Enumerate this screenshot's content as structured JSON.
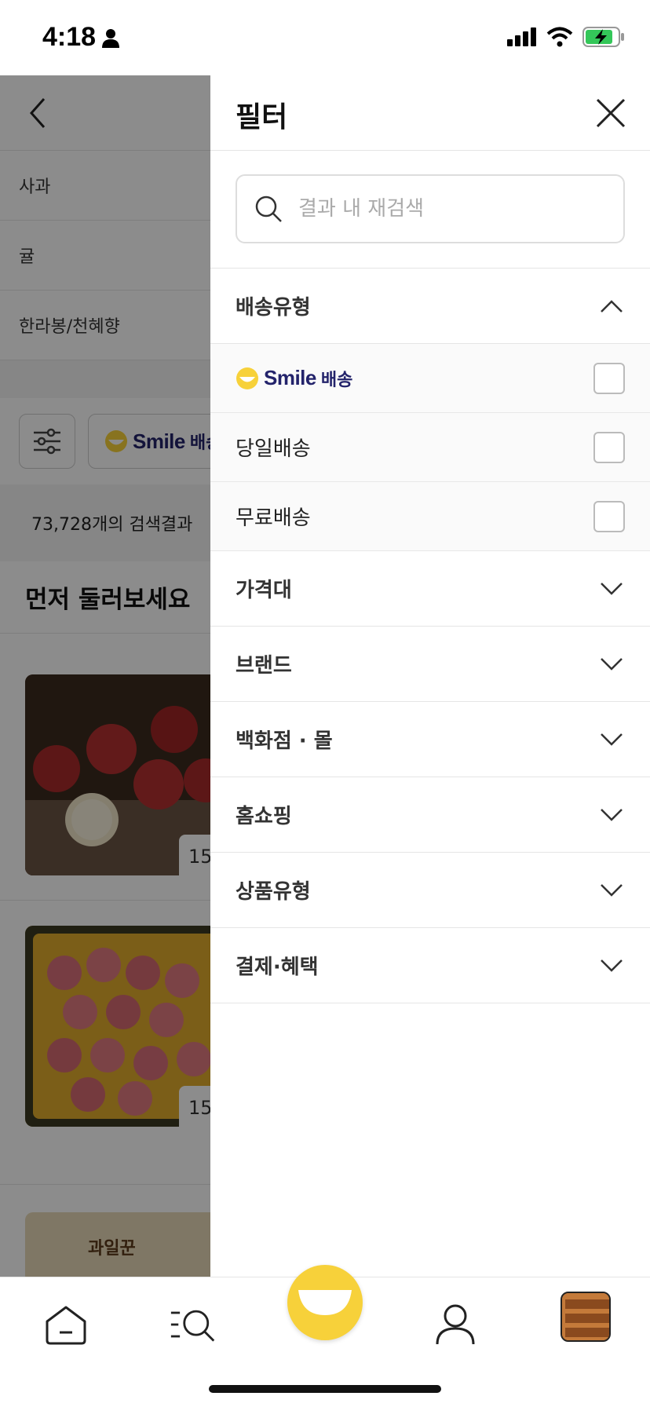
{
  "status_bar": {
    "time": "4:18"
  },
  "background": {
    "categories": [
      "사과",
      "귤",
      "한라봉/천혜향"
    ],
    "smile_chip_text": "Smile",
    "smile_chip_ko": "배송",
    "result_count": "73,728개의 검색결과",
    "section_title": "먼저 둘러보세요",
    "product_badges": [
      "15",
      "15"
    ],
    "product_badge_plus": "+",
    "brand_label": "과일꾼"
  },
  "filter": {
    "title": "필터",
    "search_placeholder": "결과 내 재검색",
    "delivery_section": "배송유형",
    "smile_text": "Smile",
    "smile_ko": "배송",
    "options": [
      "당일배송",
      "무료배송"
    ],
    "sections": [
      "가격대",
      "브랜드",
      "백화점 · 몰",
      "홈쇼핑",
      "상품유형",
      "결제·혜택"
    ]
  },
  "colors": {
    "smile_yellow": "#f7d13a",
    "smile_navy": "#23236b",
    "accent_blue": "#1f5fe0"
  }
}
